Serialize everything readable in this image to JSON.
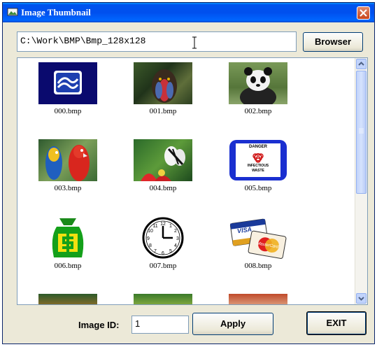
{
  "window": {
    "title": "Image Thumbnail"
  },
  "path_field": {
    "value": "C:\\Work\\BMP\\Bmp_128x128"
  },
  "browse_button": {
    "label": "Browser"
  },
  "thumbnails": [
    {
      "caption": "000.bmp",
      "icon": "blue-logo-icon"
    },
    {
      "caption": "001.bmp",
      "icon": "mandrill-photo"
    },
    {
      "caption": "002.bmp",
      "icon": "panda-photo"
    },
    {
      "caption": "003.bmp",
      "icon": "parrots-photo"
    },
    {
      "caption": "004.bmp",
      "icon": "butterfly-photo"
    },
    {
      "caption": "005.bmp",
      "icon": "infectious-waste-sign"
    },
    {
      "caption": "006.bmp",
      "icon": "money-bag-icon"
    },
    {
      "caption": "007.bmp",
      "icon": "clock-icon"
    },
    {
      "caption": "008.bmp",
      "icon": "credit-cards-icon"
    }
  ],
  "danger_sign": {
    "line1": "DANGER",
    "line2": "INFECTIOUS",
    "line3": "WASTE"
  },
  "cards": {
    "visa": "VISA",
    "mastercard": "MasterCard"
  },
  "image_id": {
    "label": "Image ID:",
    "value": "1"
  },
  "apply_button": {
    "label": "Apply"
  },
  "exit_button": {
    "label": "EXIT"
  }
}
